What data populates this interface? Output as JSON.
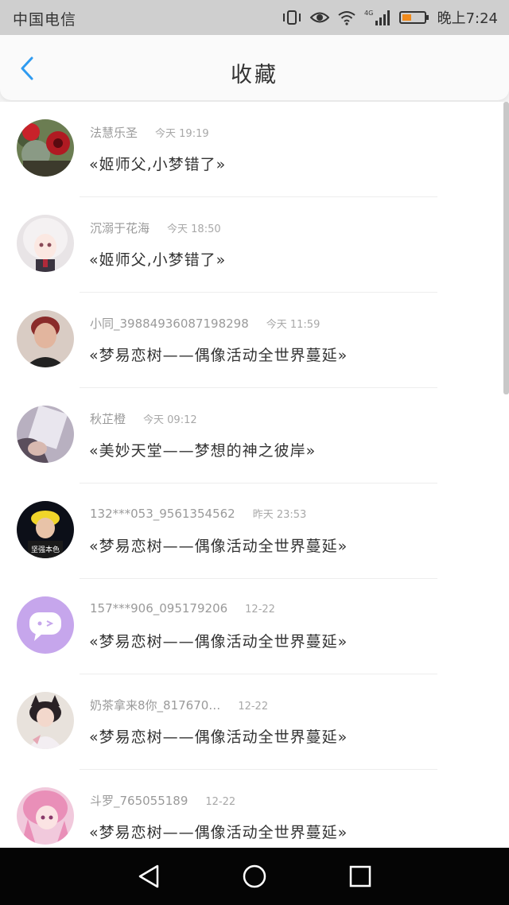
{
  "status_bar": {
    "carrier": "中国电信",
    "time": "晚上7:24",
    "network": "4G"
  },
  "header": {
    "title": "收藏",
    "back_icon": "chevron-left-icon",
    "accent_color": "#2f9bf0"
  },
  "favorites": [
    {
      "user": "法慧乐圣",
      "time": "今天 19:19",
      "title": "«姬师父,小梦错了»",
      "avatar": "cactus-flowers"
    },
    {
      "user": "沉溺于花海",
      "time": "今天 18:50",
      "title": "«姬师父,小梦错了»",
      "avatar": "anime-girl-white-hair"
    },
    {
      "user": "小同_39884936087198298",
      "time": "今天 11:59",
      "title": "«梦易恋树——偶像活动全世界蔓延»",
      "avatar": "woman-portrait"
    },
    {
      "user": "秋芷橙",
      "time": "今天 09:12",
      "title": "«美妙天堂——梦想的神之彼岸»",
      "avatar": "hand-photo"
    },
    {
      "user": "132***053_9561354562",
      "time": "昨天 23:53",
      "title": "«梦易恋树——偶像活动全世界蔓延»",
      "avatar": "boy-yellow-hat",
      "avatar_caption": "坚强本色"
    },
    {
      "user": "157***906_095179206",
      "time": "12-22",
      "title": "«梦易恋树——偶像活动全世界蔓延»",
      "avatar": "chat-bubble-default"
    },
    {
      "user": "奶茶拿来8你_817670…",
      "time": "12-22",
      "title": "«梦易恋树——偶像活动全世界蔓延»",
      "avatar": "girl-with-cat-ears"
    },
    {
      "user": "斗罗_765055189",
      "time": "12-22",
      "title": "«梦易恋树——偶像活动全世界蔓延»",
      "avatar": "anime-girl-pink-hair"
    }
  ],
  "nav_bar": {
    "back": "triangle-back-icon",
    "home": "circle-home-icon",
    "recents": "square-recents-icon"
  }
}
